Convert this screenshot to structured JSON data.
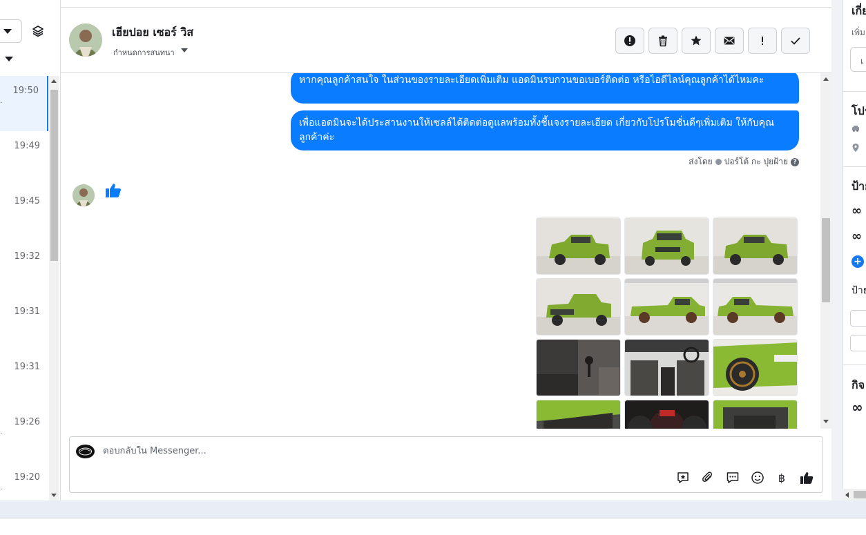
{
  "left_panel": {
    "times": [
      "19:50",
      "19:49",
      "19:45",
      "19:32",
      "19:31",
      "19:31",
      "19:26",
      "19:20"
    ]
  },
  "header": {
    "contact_name": "เฮียปอย เซอร์ วิส",
    "assign_label": "กำหนดการสนทนา",
    "actions": [
      "alert-circle",
      "trash",
      "star",
      "envelope",
      "exclamation",
      "check"
    ]
  },
  "messages": {
    "bubble_1": "หากคุณลูกค้าสนใจ ในส่วนของรายละเอียดเพิ่มเติม แอดมินรบกวนขอเบอร์ติดต่อ หรือไอดีไลน์คุณลูกค้าได้ไหมคะ",
    "bubble_2": "เพื่อแอดมินจะได้ประสานงานให้เซลล์ได้ติดต่อดูแลพร้อมทั้งชี้แจงรายละเอียด เกี่ยวกับโปรโมชั่นดีๆเพิ่มเติม ให้กับคุณลูกค้าค่ะ",
    "sent_by_prefix": "ส่งโดย",
    "sent_by_name": "ปอร์โต้ กะ ปุยฝ้าย",
    "accent_color": "#0a7cff"
  },
  "composer": {
    "placeholder": "ตอบกลับใน Messenger...",
    "baht_symbol": "฿"
  },
  "right_panel": {
    "heading_1": "เกี่ย",
    "sub_1": "เพิ่ม",
    "heading_2": "โปร",
    "heading_3": "ป้าย",
    "label_1": "ป้าย",
    "heading_4": "กิจ"
  }
}
